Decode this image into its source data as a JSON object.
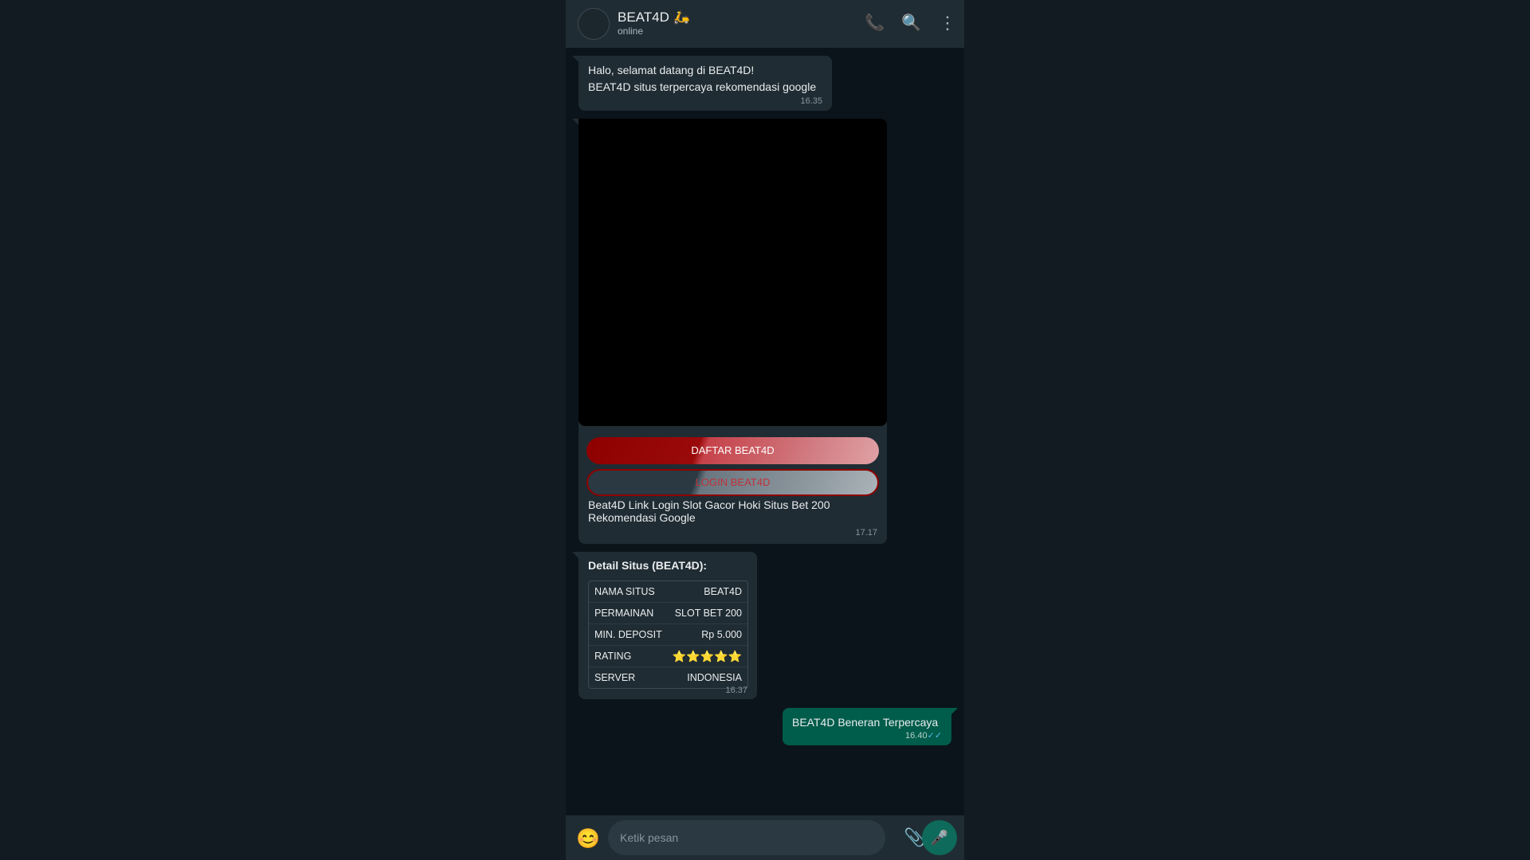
{
  "header": {
    "title": "BEAT4D 🛵",
    "status": "online",
    "icons": {
      "call": "phone-icon",
      "search": "search-icon",
      "menu": "kebab-menu-icon"
    }
  },
  "messages": {
    "welcome": {
      "line1": "Halo, selamat datang di BEAT4D!",
      "line2": "BEAT4D situs terpercaya rekomendasi google",
      "time": "16.35"
    },
    "media": {
      "button_register": "DAFTAR BEAT4D",
      "button_login": "LOGIN BEAT4D",
      "caption": "Beat4D Link Login Slot Gacor Hoki Situs Bet 200 Rekomendasi Google",
      "time": "17.17"
    },
    "detail": {
      "title": "Detail Situs (BEAT4D):",
      "rows": [
        {
          "key": "NAMA SITUS",
          "value": "BEAT4D"
        },
        {
          "key": "PERMAINAN",
          "value": "SLOT BET 200"
        },
        {
          "key": "MIN. DEPOSIT",
          "value": "Rp 5.000"
        },
        {
          "key": "RATING",
          "value": "⭐⭐⭐⭐⭐"
        },
        {
          "key": "SERVER",
          "value": "INDONESIA"
        }
      ],
      "time": "16.37"
    },
    "outgoing": {
      "text": "BEAT4D Beneran Terpercaya",
      "time": "16.40",
      "ticks": "✓✓"
    }
  },
  "composer": {
    "placeholder": "Ketik pesan",
    "icons": {
      "emoji": "emoji-icon",
      "attach": "paperclip-icon",
      "mic": "microphone-icon"
    }
  },
  "colors": {
    "background": "#0b141a",
    "header": "#202c33",
    "incoming_bubble": "#202c33",
    "outgoing_bubble": "#005c4b",
    "register_button": "#8e0000"
  }
}
